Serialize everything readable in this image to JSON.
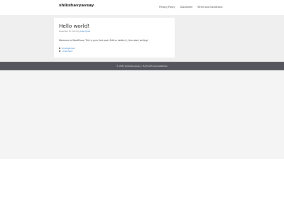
{
  "site": {
    "title": "shikshavyavsay"
  },
  "nav": {
    "items": [
      "Privacy Policy",
      "Disclaimer",
      "Terms and Conditions"
    ]
  },
  "post": {
    "title": "Hello world!",
    "meta_prefix": "November 30, 2023 by ",
    "author": "Anand Joshi",
    "body": "Welcome to WordPress. This is your first post. Edit or delete it, then start writing!",
    "category": "Uncategorized",
    "comments": "1 Comment"
  },
  "footer": {
    "text": "© 2024 shikshavyavsay • Built with GeneratePress"
  }
}
